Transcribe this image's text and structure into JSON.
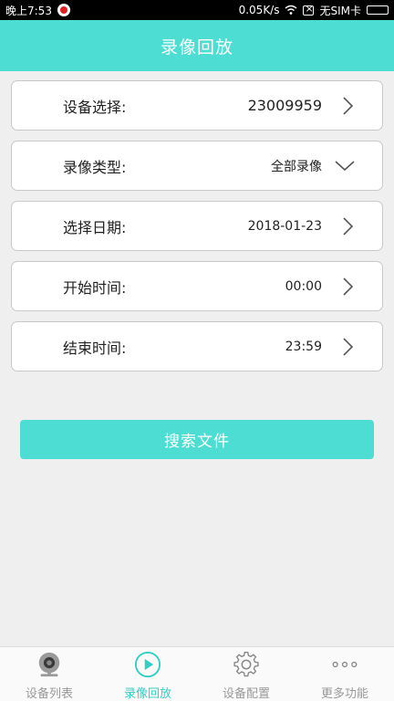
{
  "status_bar": {
    "time": "晚上7:53",
    "speed": "0.05K/s",
    "sim": "无SIM卡"
  },
  "header": {
    "title": "录像回放"
  },
  "form": {
    "device": {
      "label": "设备选择:",
      "value": "23009959"
    },
    "record_type": {
      "label": "录像类型:",
      "value": "全部录像"
    },
    "date": {
      "label": "选择日期:",
      "value": "2018-01-23"
    },
    "start_time": {
      "label": "开始时间:",
      "value": "00:00"
    },
    "end_time": {
      "label": "结束时间:",
      "value": "23:59"
    }
  },
  "search_button": {
    "label": "搜索文件"
  },
  "nav": {
    "items": [
      {
        "label": "设备列表",
        "icon": "camera-icon"
      },
      {
        "label": "录像回放",
        "icon": "play-icon",
        "active": true
      },
      {
        "label": "设备配置",
        "icon": "gear-icon"
      },
      {
        "label": "更多功能",
        "icon": "more-icon"
      }
    ]
  },
  "colors": {
    "accent": "#4dddd3",
    "active_nav": "#33cfc4"
  }
}
